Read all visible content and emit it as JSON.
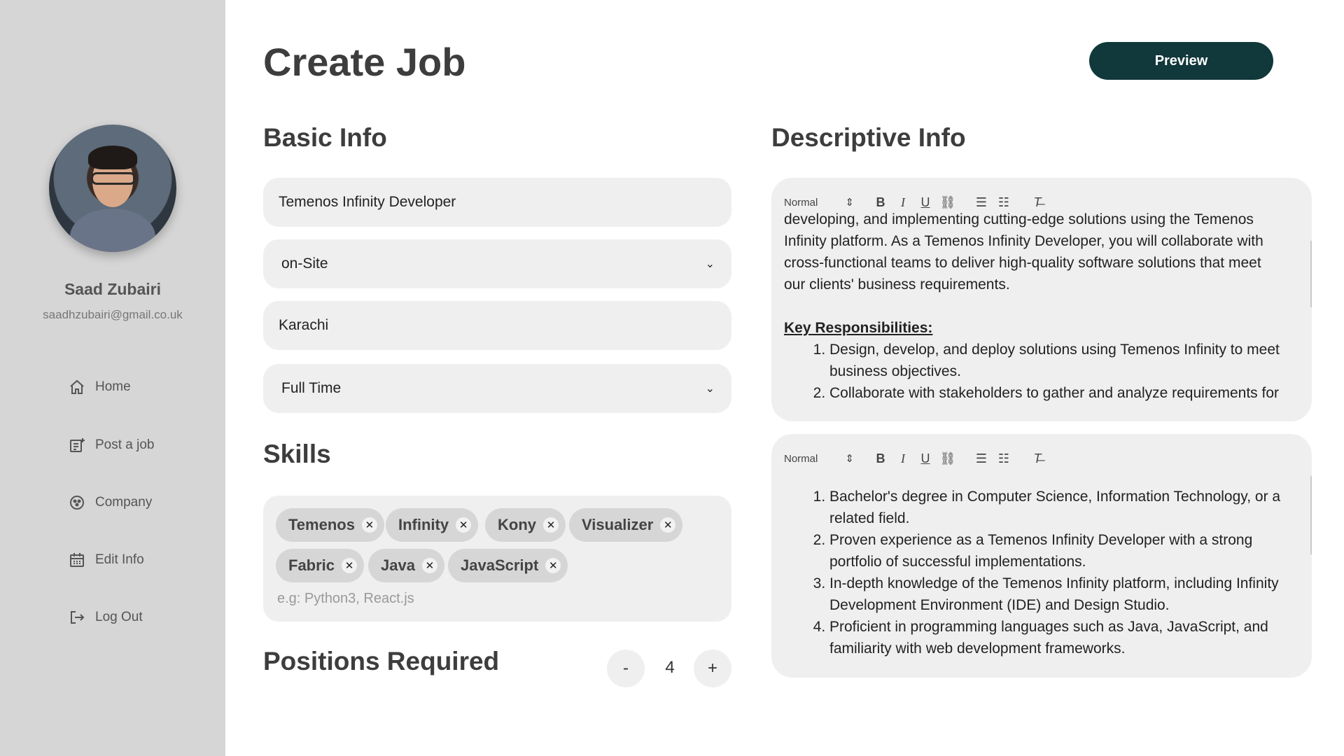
{
  "sidebar": {
    "user": {
      "name": "Saad Zubairi",
      "email": "saadhzubairi@gmail.co.uk"
    },
    "nav": [
      {
        "label": "Home",
        "icon": "home-icon"
      },
      {
        "label": "Post a job",
        "icon": "post-job-icon"
      },
      {
        "label": "Company",
        "icon": "company-icon"
      },
      {
        "label": "Edit Info",
        "icon": "calendar-icon"
      },
      {
        "label": "Log Out",
        "icon": "logout-icon"
      }
    ]
  },
  "header": {
    "title": "Create Job",
    "preview_label": "Preview"
  },
  "basic_info": {
    "title": "Basic Info",
    "job_title": "Temenos Infinity Developer",
    "work_mode": "on-Site",
    "location": "Karachi",
    "employment_type": "Full Time"
  },
  "skills": {
    "title": "Skills",
    "items": [
      "Temenos",
      "Infinity",
      "Kony",
      "Visualizer",
      "Fabric",
      "Java",
      "JavaScript"
    ],
    "placeholder": "e.g: Python3, React.js"
  },
  "positions": {
    "title": "Positions Required",
    "minus": "-",
    "plus": "+",
    "value": "4"
  },
  "descriptive_info": {
    "title": "Descriptive Info",
    "toolbar": {
      "format": "Normal"
    },
    "description": {
      "lines": [
        "developing, and implementing cutting-edge solutions using the Temenos",
        "Infinity platform. As a Temenos Infinity Developer, you will collaborate with",
        "cross-functional teams to deliver high-quality software solutions that meet",
        "our clients' business requirements."
      ],
      "heading": "Key Responsibilities:",
      "list": [
        "Design, develop, and deploy solutions using Temenos Infinity to meet business objectives.",
        "Collaborate with stakeholders to gather and analyze requirements for"
      ]
    },
    "requirements": {
      "list": [
        "Bachelor's degree in Computer Science, Information Technology, or a related field.",
        "Proven experience as a Temenos Infinity Developer with a strong portfolio of successful implementations.",
        "In-depth knowledge of the Temenos Infinity platform, including Infinity Development Environment (IDE) and Design Studio.",
        "Proficient in programming languages such as Java, JavaScript, and familiarity with web development frameworks."
      ]
    }
  }
}
